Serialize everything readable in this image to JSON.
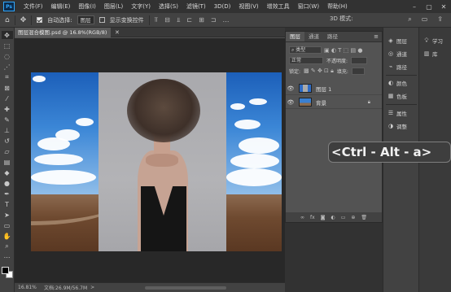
{
  "app": {
    "logo": "Ps"
  },
  "menubar": {
    "items": [
      "文件(F)",
      "编辑(E)",
      "图像(I)",
      "图层(L)",
      "文字(Y)",
      "选择(S)",
      "滤镜(T)",
      "3D(D)",
      "视图(V)",
      "增效工具",
      "窗口(W)",
      "帮助(H)"
    ]
  },
  "options_bar": {
    "auto_select_label": "自动选择:",
    "auto_select_value": "图层",
    "show_transform_label": "显示变换控件",
    "mode_3d": "3D 模式:"
  },
  "document": {
    "tab_title": "图层混合模图.psd @ 16.8%(RGB/8)",
    "zoom": "16.81%",
    "info": "文档:26.9M/56.7M",
    "status_more": ">"
  },
  "layers_panel": {
    "tabs": [
      "图层",
      "通道",
      "路径"
    ],
    "active_tab": 0,
    "filter_kind": "类型",
    "blend_mode": "正常",
    "opacity_label": "不透明度:",
    "lock_label": "锁定:",
    "fill_label": "填充:",
    "layers": [
      {
        "name": "图层 1",
        "visible": true
      },
      {
        "name": "背景",
        "visible": true,
        "locked": true
      }
    ]
  },
  "dock_a": {
    "items": [
      {
        "label": "图层",
        "icon": "layers-icon"
      },
      {
        "label": "通道",
        "icon": "channels-icon"
      },
      {
        "label": "路径",
        "icon": "paths-icon"
      },
      {
        "label": "颜色",
        "icon": "color-icon"
      },
      {
        "label": "色板",
        "icon": "swatches-icon"
      },
      {
        "label": "属性",
        "icon": "properties-icon"
      },
      {
        "label": "调整",
        "icon": "adjustments-icon"
      }
    ]
  },
  "dock_b": {
    "items": [
      {
        "label": "学习",
        "icon": "learn-icon"
      },
      {
        "label": "库",
        "icon": "libraries-icon"
      }
    ]
  },
  "overlay": {
    "shortcut": "<Ctrl - Alt - a>"
  }
}
